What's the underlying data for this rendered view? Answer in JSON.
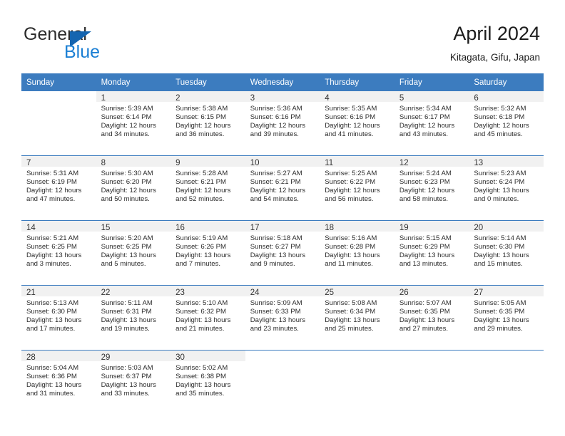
{
  "brand": {
    "name_part1": "General",
    "name_part2": "Blue",
    "triangle_icon": "triangle-icon",
    "accent_dark": "#1565b0",
    "accent_light": "#1b7fd4"
  },
  "header": {
    "title": "April 2024",
    "subtitle": "Kitagata, Gifu, Japan"
  },
  "theme": {
    "header_bg": "#3c7cbf",
    "daynum_bg": "#f1f1f1",
    "text": "#2c2c2c"
  },
  "weekday_headers": [
    "Sunday",
    "Monday",
    "Tuesday",
    "Wednesday",
    "Thursday",
    "Friday",
    "Saturday"
  ],
  "weeks": [
    [
      {
        "day": "",
        "sunrise": "",
        "sunset": "",
        "daylight1": "",
        "daylight2": ""
      },
      {
        "day": "1",
        "sunrise": "Sunrise: 5:39 AM",
        "sunset": "Sunset: 6:14 PM",
        "daylight1": "Daylight: 12 hours",
        "daylight2": "and 34 minutes."
      },
      {
        "day": "2",
        "sunrise": "Sunrise: 5:38 AM",
        "sunset": "Sunset: 6:15 PM",
        "daylight1": "Daylight: 12 hours",
        "daylight2": "and 36 minutes."
      },
      {
        "day": "3",
        "sunrise": "Sunrise: 5:36 AM",
        "sunset": "Sunset: 6:16 PM",
        "daylight1": "Daylight: 12 hours",
        "daylight2": "and 39 minutes."
      },
      {
        "day": "4",
        "sunrise": "Sunrise: 5:35 AM",
        "sunset": "Sunset: 6:16 PM",
        "daylight1": "Daylight: 12 hours",
        "daylight2": "and 41 minutes."
      },
      {
        "day": "5",
        "sunrise": "Sunrise: 5:34 AM",
        "sunset": "Sunset: 6:17 PM",
        "daylight1": "Daylight: 12 hours",
        "daylight2": "and 43 minutes."
      },
      {
        "day": "6",
        "sunrise": "Sunrise: 5:32 AM",
        "sunset": "Sunset: 6:18 PM",
        "daylight1": "Daylight: 12 hours",
        "daylight2": "and 45 minutes."
      }
    ],
    [
      {
        "day": "7",
        "sunrise": "Sunrise: 5:31 AM",
        "sunset": "Sunset: 6:19 PM",
        "daylight1": "Daylight: 12 hours",
        "daylight2": "and 47 minutes."
      },
      {
        "day": "8",
        "sunrise": "Sunrise: 5:30 AM",
        "sunset": "Sunset: 6:20 PM",
        "daylight1": "Daylight: 12 hours",
        "daylight2": "and 50 minutes."
      },
      {
        "day": "9",
        "sunrise": "Sunrise: 5:28 AM",
        "sunset": "Sunset: 6:21 PM",
        "daylight1": "Daylight: 12 hours",
        "daylight2": "and 52 minutes."
      },
      {
        "day": "10",
        "sunrise": "Sunrise: 5:27 AM",
        "sunset": "Sunset: 6:21 PM",
        "daylight1": "Daylight: 12 hours",
        "daylight2": "and 54 minutes."
      },
      {
        "day": "11",
        "sunrise": "Sunrise: 5:25 AM",
        "sunset": "Sunset: 6:22 PM",
        "daylight1": "Daylight: 12 hours",
        "daylight2": "and 56 minutes."
      },
      {
        "day": "12",
        "sunrise": "Sunrise: 5:24 AM",
        "sunset": "Sunset: 6:23 PM",
        "daylight1": "Daylight: 12 hours",
        "daylight2": "and 58 minutes."
      },
      {
        "day": "13",
        "sunrise": "Sunrise: 5:23 AM",
        "sunset": "Sunset: 6:24 PM",
        "daylight1": "Daylight: 13 hours",
        "daylight2": "and 0 minutes."
      }
    ],
    [
      {
        "day": "14",
        "sunrise": "Sunrise: 5:21 AM",
        "sunset": "Sunset: 6:25 PM",
        "daylight1": "Daylight: 13 hours",
        "daylight2": "and 3 minutes."
      },
      {
        "day": "15",
        "sunrise": "Sunrise: 5:20 AM",
        "sunset": "Sunset: 6:25 PM",
        "daylight1": "Daylight: 13 hours",
        "daylight2": "and 5 minutes."
      },
      {
        "day": "16",
        "sunrise": "Sunrise: 5:19 AM",
        "sunset": "Sunset: 6:26 PM",
        "daylight1": "Daylight: 13 hours",
        "daylight2": "and 7 minutes."
      },
      {
        "day": "17",
        "sunrise": "Sunrise: 5:18 AM",
        "sunset": "Sunset: 6:27 PM",
        "daylight1": "Daylight: 13 hours",
        "daylight2": "and 9 minutes."
      },
      {
        "day": "18",
        "sunrise": "Sunrise: 5:16 AM",
        "sunset": "Sunset: 6:28 PM",
        "daylight1": "Daylight: 13 hours",
        "daylight2": "and 11 minutes."
      },
      {
        "day": "19",
        "sunrise": "Sunrise: 5:15 AM",
        "sunset": "Sunset: 6:29 PM",
        "daylight1": "Daylight: 13 hours",
        "daylight2": "and 13 minutes."
      },
      {
        "day": "20",
        "sunrise": "Sunrise: 5:14 AM",
        "sunset": "Sunset: 6:30 PM",
        "daylight1": "Daylight: 13 hours",
        "daylight2": "and 15 minutes."
      }
    ],
    [
      {
        "day": "21",
        "sunrise": "Sunrise: 5:13 AM",
        "sunset": "Sunset: 6:30 PM",
        "daylight1": "Daylight: 13 hours",
        "daylight2": "and 17 minutes."
      },
      {
        "day": "22",
        "sunrise": "Sunrise: 5:11 AM",
        "sunset": "Sunset: 6:31 PM",
        "daylight1": "Daylight: 13 hours",
        "daylight2": "and 19 minutes."
      },
      {
        "day": "23",
        "sunrise": "Sunrise: 5:10 AM",
        "sunset": "Sunset: 6:32 PM",
        "daylight1": "Daylight: 13 hours",
        "daylight2": "and 21 minutes."
      },
      {
        "day": "24",
        "sunrise": "Sunrise: 5:09 AM",
        "sunset": "Sunset: 6:33 PM",
        "daylight1": "Daylight: 13 hours",
        "daylight2": "and 23 minutes."
      },
      {
        "day": "25",
        "sunrise": "Sunrise: 5:08 AM",
        "sunset": "Sunset: 6:34 PM",
        "daylight1": "Daylight: 13 hours",
        "daylight2": "and 25 minutes."
      },
      {
        "day": "26",
        "sunrise": "Sunrise: 5:07 AM",
        "sunset": "Sunset: 6:35 PM",
        "daylight1": "Daylight: 13 hours",
        "daylight2": "and 27 minutes."
      },
      {
        "day": "27",
        "sunrise": "Sunrise: 5:05 AM",
        "sunset": "Sunset: 6:35 PM",
        "daylight1": "Daylight: 13 hours",
        "daylight2": "and 29 minutes."
      }
    ],
    [
      {
        "day": "28",
        "sunrise": "Sunrise: 5:04 AM",
        "sunset": "Sunset: 6:36 PM",
        "daylight1": "Daylight: 13 hours",
        "daylight2": "and 31 minutes."
      },
      {
        "day": "29",
        "sunrise": "Sunrise: 5:03 AM",
        "sunset": "Sunset: 6:37 PM",
        "daylight1": "Daylight: 13 hours",
        "daylight2": "and 33 minutes."
      },
      {
        "day": "30",
        "sunrise": "Sunrise: 5:02 AM",
        "sunset": "Sunset: 6:38 PM",
        "daylight1": "Daylight: 13 hours",
        "daylight2": "and 35 minutes."
      },
      {
        "day": "",
        "sunrise": "",
        "sunset": "",
        "daylight1": "",
        "daylight2": ""
      },
      {
        "day": "",
        "sunrise": "",
        "sunset": "",
        "daylight1": "",
        "daylight2": ""
      },
      {
        "day": "",
        "sunrise": "",
        "sunset": "",
        "daylight1": "",
        "daylight2": ""
      },
      {
        "day": "",
        "sunrise": "",
        "sunset": "",
        "daylight1": "",
        "daylight2": ""
      }
    ]
  ]
}
